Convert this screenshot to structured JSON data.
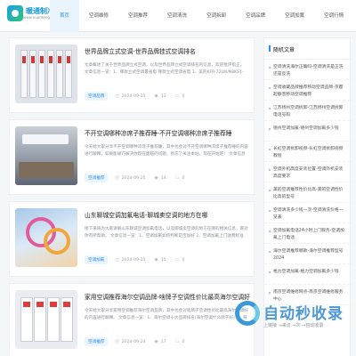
{
  "header": {
    "logo_text": "暖通制冷网",
    "logo_sub": "www.nuantong.com",
    "nav": [
      "首页",
      "空调维修",
      "空调推荐",
      "空调清洗",
      "空调拆卸",
      "空调品牌",
      "空调加氟",
      "空调行情"
    ],
    "active_index": 0
  },
  "articles": [
    {
      "title": "世界品牌立式空调-世界品牌挂式空调排名",
      "excerpt": "文章概述了关于世界品牌立式空调，以及世界品牌立式空调排名的信息，欢迎批评指正。 文章信息一览：1、哪款立式空调最省电 哪款立式空调省电 1、美的KFR-72LW/N8KS1-1P，作为一款性价比...",
      "category": "空调品牌",
      "date": "2024-09-25",
      "views": "12",
      "comments": "0"
    },
    {
      "title": "不开空调哪种凉席子推荐睡-不开空调哪种凉席子推荐睡",
      "excerpt": "今天给大家分享不开空调哪种凉席子推荐睡，其中也会对不开空调哪种凉席子推荐睡的内容进行解释，如果能碰巧解决你现在面临的问题，别忘了关注本站，现在开始吧！ 文章信息一览：1、大学宿舍不开空调，凉席还是冰丝席...",
      "category": "空调推荐",
      "date": "2024-09-25",
      "views": "14",
      "comments": "0"
    },
    {
      "title": "山东聊城空调加氟电话-聊城卖空调的地方在哪",
      "excerpt": "接下来将为大家讲解山东聊城空调加氟电话，以及聊城卖空调的地方在哪的相关信息，愿对你有所帮助。 文章信息一览：1、空调加氟如何判断是否加好 2、空调加氟上门收费标准 空调加氟上门收费标准",
      "category": "空调加氟",
      "date": "2024-09-25",
      "views": "15",
      "comments": "0"
    },
    {
      "title": "家用空调推荐海尔空调品牌-啥牌子空调性价比最高海尔空调好",
      "excerpt": "今天给大家分享家用空调推荐海尔空调品牌，其中也会对啥牌子空调性价比最高海尔空调好的内容进行解释。 文章信息一览：1、海尔空调十大品牌排名(海尔空调什么牌子好) 2、海尔空调好不好",
      "category": "空调推荐",
      "date": "2024-09-24",
      "views": "17",
      "comments": "0"
    }
  ],
  "sidebar": {
    "title": "随机文章",
    "items": [
      "空调清洗海尔正确吗-空调清洗是正洗还是反洗",
      "空调收藏品牌推荐移动空调品牌-京都超静音移动空调推荐",
      "江苏扬州空调拆卸-江苏扬州空调拆卸电话号码",
      "德州空调加氟-德州空调加氟多少钱",
      "长虹空调拆卸视频-长虹空调拆卸视频教程",
      "空调外机高度安装位置-空调外机安装高度要求",
      "美的空调推荐性价比高-美的空调性价比高的型号",
      "空调清洗多少钱一次-空调清洗价格一览表",
      "空调加氟电话24小时上门服务-空调加氟上门电话",
      "海尔空调推荐哪款-海尔空调推荐型号2024",
      "格力空调加氟-格力空调加氟多少钱",
      "南京空调维修网点-南京空调维修服务中心"
    ]
  },
  "watermark": {
    "text": "自动秒收录",
    "sub": "上链接 →来访 →次 →自动收录"
  }
}
